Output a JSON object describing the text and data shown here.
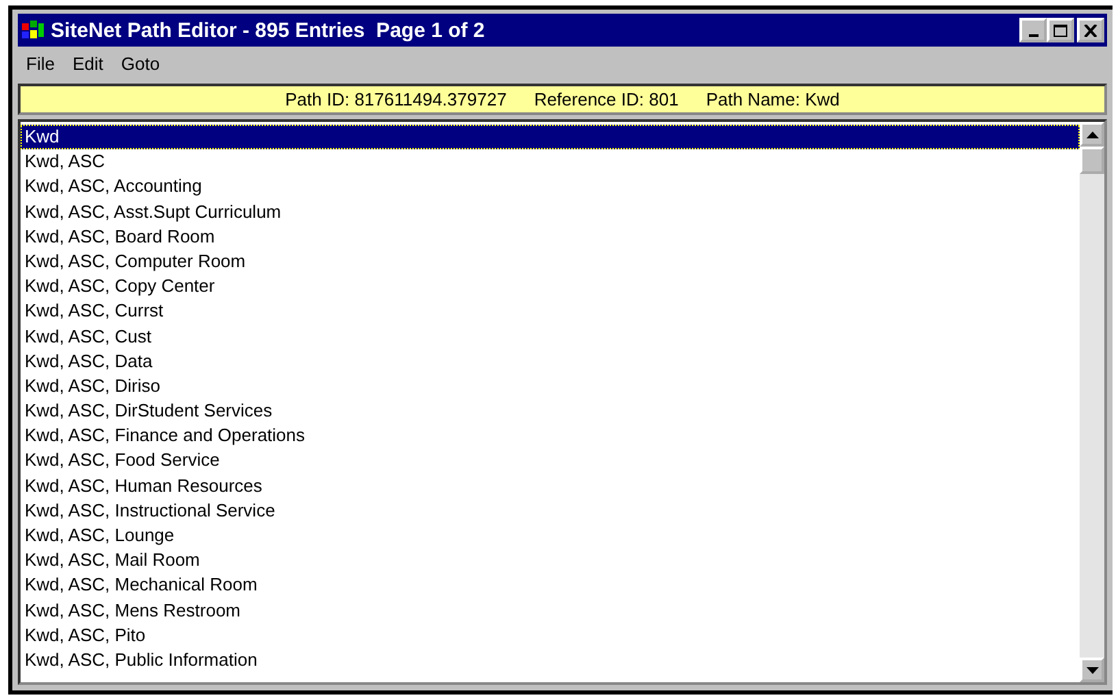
{
  "window": {
    "title": "SiteNet Path Editor - 895 Entries  Page 1 of 2"
  },
  "menu": [
    "File",
    "Edit",
    "Goto"
  ],
  "info_bar": [
    "Path ID: 817611494.379727",
    "Reference ID: 801",
    "Path Name: Kwd"
  ],
  "list": [
    {
      "label": "Kwd",
      "selected": true
    },
    {
      "label": "Kwd, ASC",
      "selected": false
    },
    {
      "label": "Kwd, ASC, Accounting",
      "selected": false
    },
    {
      "label": "Kwd, ASC, Asst.Supt Curriculum",
      "selected": false
    },
    {
      "label": "Kwd, ASC, Board Room",
      "selected": false
    },
    {
      "label": "Kwd, ASC, Computer Room",
      "selected": false
    },
    {
      "label": "Kwd, ASC, Copy Center",
      "selected": false
    },
    {
      "label": "Kwd, ASC, Currst",
      "selected": false
    },
    {
      "label": "Kwd, ASC, Cust",
      "selected": false
    },
    {
      "label": "Kwd, ASC, Data",
      "selected": false
    },
    {
      "label": "Kwd, ASC, Diriso",
      "selected": false
    },
    {
      "label": "Kwd, ASC, DirStudent Services",
      "selected": false
    },
    {
      "label": "Kwd, ASC, Finance and Operations",
      "selected": false
    },
    {
      "label": "Kwd, ASC, Food Service",
      "selected": false
    },
    {
      "label": "Kwd, ASC, Human Resources",
      "selected": false
    },
    {
      "label": "Kwd, ASC, Instructional Service",
      "selected": false
    },
    {
      "label": "Kwd, ASC, Lounge",
      "selected": false
    },
    {
      "label": "Kwd, ASC, Mail Room",
      "selected": false
    },
    {
      "label": "Kwd, ASC, Mechanical Room",
      "selected": false
    },
    {
      "label": "Kwd, ASC, Mens Restroom",
      "selected": false
    },
    {
      "label": "Kwd, ASC, Pito",
      "selected": false
    },
    {
      "label": "Kwd, ASC, Public Information",
      "selected": false
    }
  ]
}
